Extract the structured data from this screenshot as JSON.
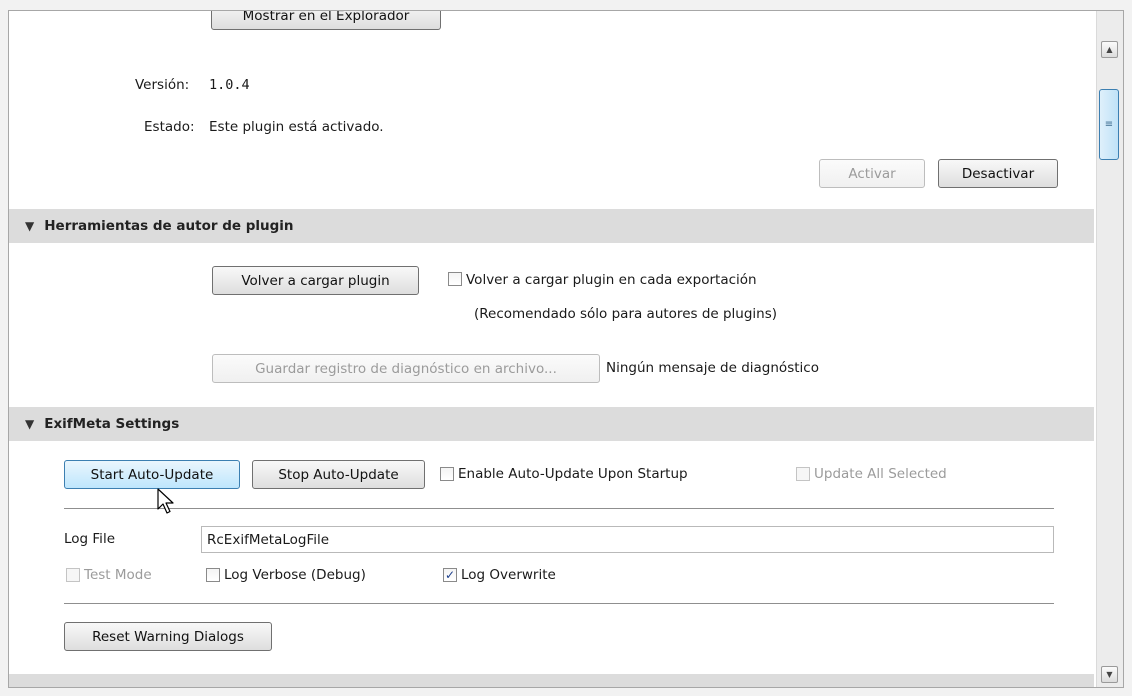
{
  "top_section": {
    "show_in_explorer_label": "Mostrar en el Explorador",
    "version_label": "Versión:",
    "version_value": "1.0.4",
    "status_label": "Estado:",
    "status_value": "Este plugin está activado.",
    "activate_label": "Activar",
    "deactivate_label": "Desactivar"
  },
  "author_tools": {
    "header": "Herramientas de autor de plugin",
    "reload_label": "Volver a cargar plugin",
    "reload_each_export_label": "Volver a cargar plugin en cada exportación",
    "reload_each_export_checked": false,
    "recommended_note": "(Recomendado sólo para autores de plugins)",
    "save_log_label": "Guardar registro de diagnóstico en archivo...",
    "diagnostic_message": "Ningún mensaje de diagnóstico"
  },
  "exifmeta": {
    "header": "ExifMeta Settings",
    "start_auto_update_label": "Start Auto-Update",
    "stop_auto_update_label": "Stop Auto-Update",
    "enable_on_startup_label": "Enable Auto-Update Upon Startup",
    "enable_on_startup_checked": false,
    "update_all_selected_label": "Update All Selected",
    "update_all_selected_checked": false,
    "log_file_label": "Log File",
    "log_file_value": "RcExifMetaLogFile",
    "test_mode_label": "Test Mode",
    "test_mode_checked": false,
    "log_verbose_label": "Log Verbose (Debug)",
    "log_verbose_checked": false,
    "log_overwrite_label": "Log Overwrite",
    "log_overwrite_checked": true,
    "reset_warning_label": "Reset Warning Dialogs"
  },
  "icons": {
    "section_expanded": "triangle-down-icon",
    "checkmark": "checkmark-icon",
    "scroll_up": "arrow-up-icon",
    "scroll_down": "arrow-down-icon",
    "cursor": "mouse-pointer-icon"
  },
  "colors": {
    "section_header_bg": "#dcdcdc",
    "active_button_border": "#3c7fb1",
    "disabled_text": "#9b9b9b"
  }
}
